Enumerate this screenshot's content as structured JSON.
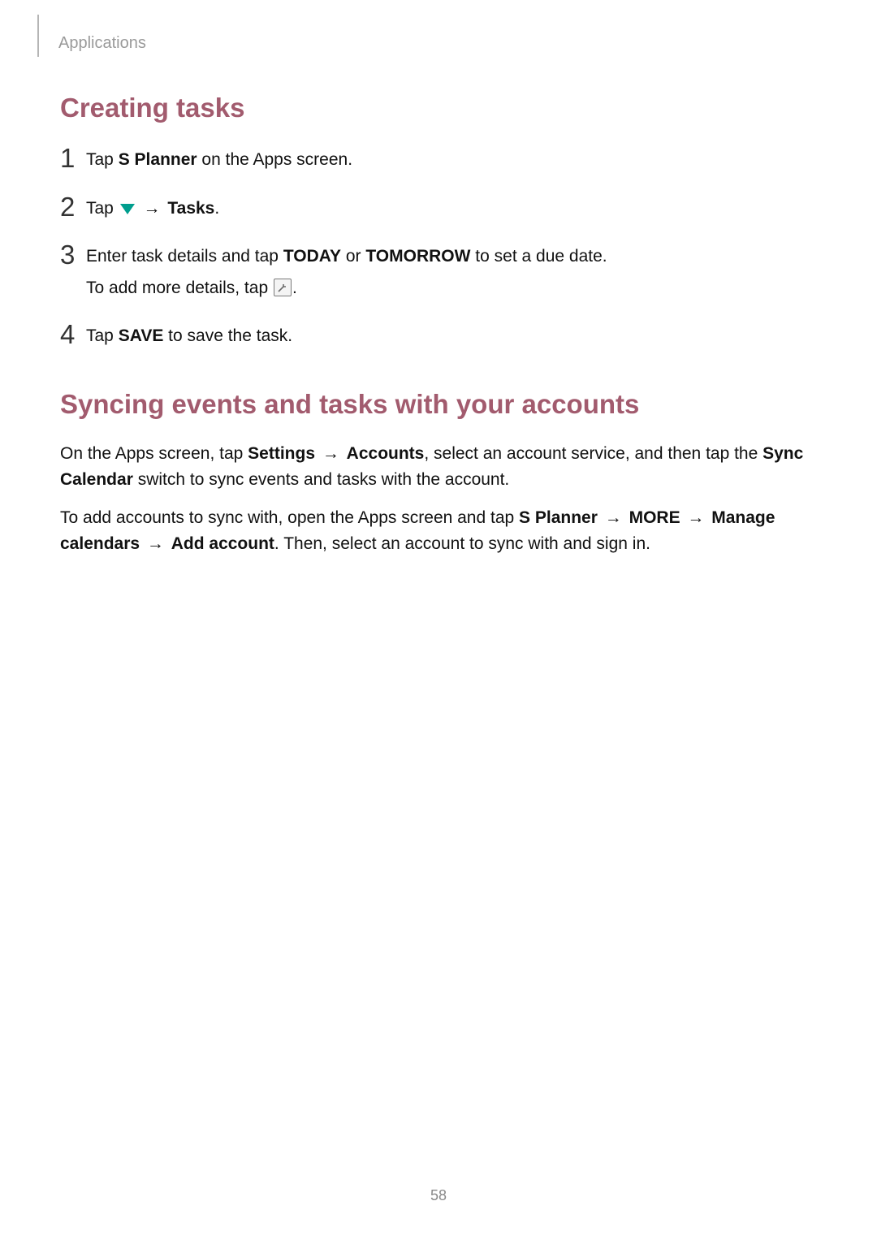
{
  "header": {
    "category": "Applications"
  },
  "section1": {
    "heading": "Creating tasks",
    "steps": {
      "s1": {
        "prefix": "Tap ",
        "bold": "S Planner",
        "suffix": " on the Apps screen."
      },
      "s2": {
        "prefix": "Tap ",
        "arrow": " → ",
        "bold": "Tasks",
        "suffix": "."
      },
      "s3": {
        "line1_prefix": "Enter task details and tap ",
        "line1_bold1": "TODAY",
        "line1_mid": " or ",
        "line1_bold2": "TOMORROW",
        "line1_suffix": " to set a due date.",
        "line2_prefix": "To add more details, tap ",
        "line2_suffix": "."
      },
      "s4": {
        "prefix": "Tap ",
        "bold": "SAVE",
        "suffix": " to save the task."
      }
    }
  },
  "section2": {
    "heading": "Syncing events and tasks with your accounts",
    "para1": {
      "t1": "On the Apps screen, tap ",
      "b1": "Settings",
      "arrow1": " → ",
      "b2": "Accounts",
      "t2": ", select an account service, and then tap the ",
      "b3": "Sync Calendar",
      "t3": " switch to sync events and tasks with the account."
    },
    "para2": {
      "t1": "To add accounts to sync with, open the Apps screen and tap ",
      "b1": "S Planner",
      "arrow1": " → ",
      "b2": "MORE",
      "arrow2": " → ",
      "b3": "Manage calendars",
      "arrow3": " → ",
      "b4": "Add account",
      "t2": ". Then, select an account to sync with and sign in."
    }
  },
  "pageNumber": "58"
}
